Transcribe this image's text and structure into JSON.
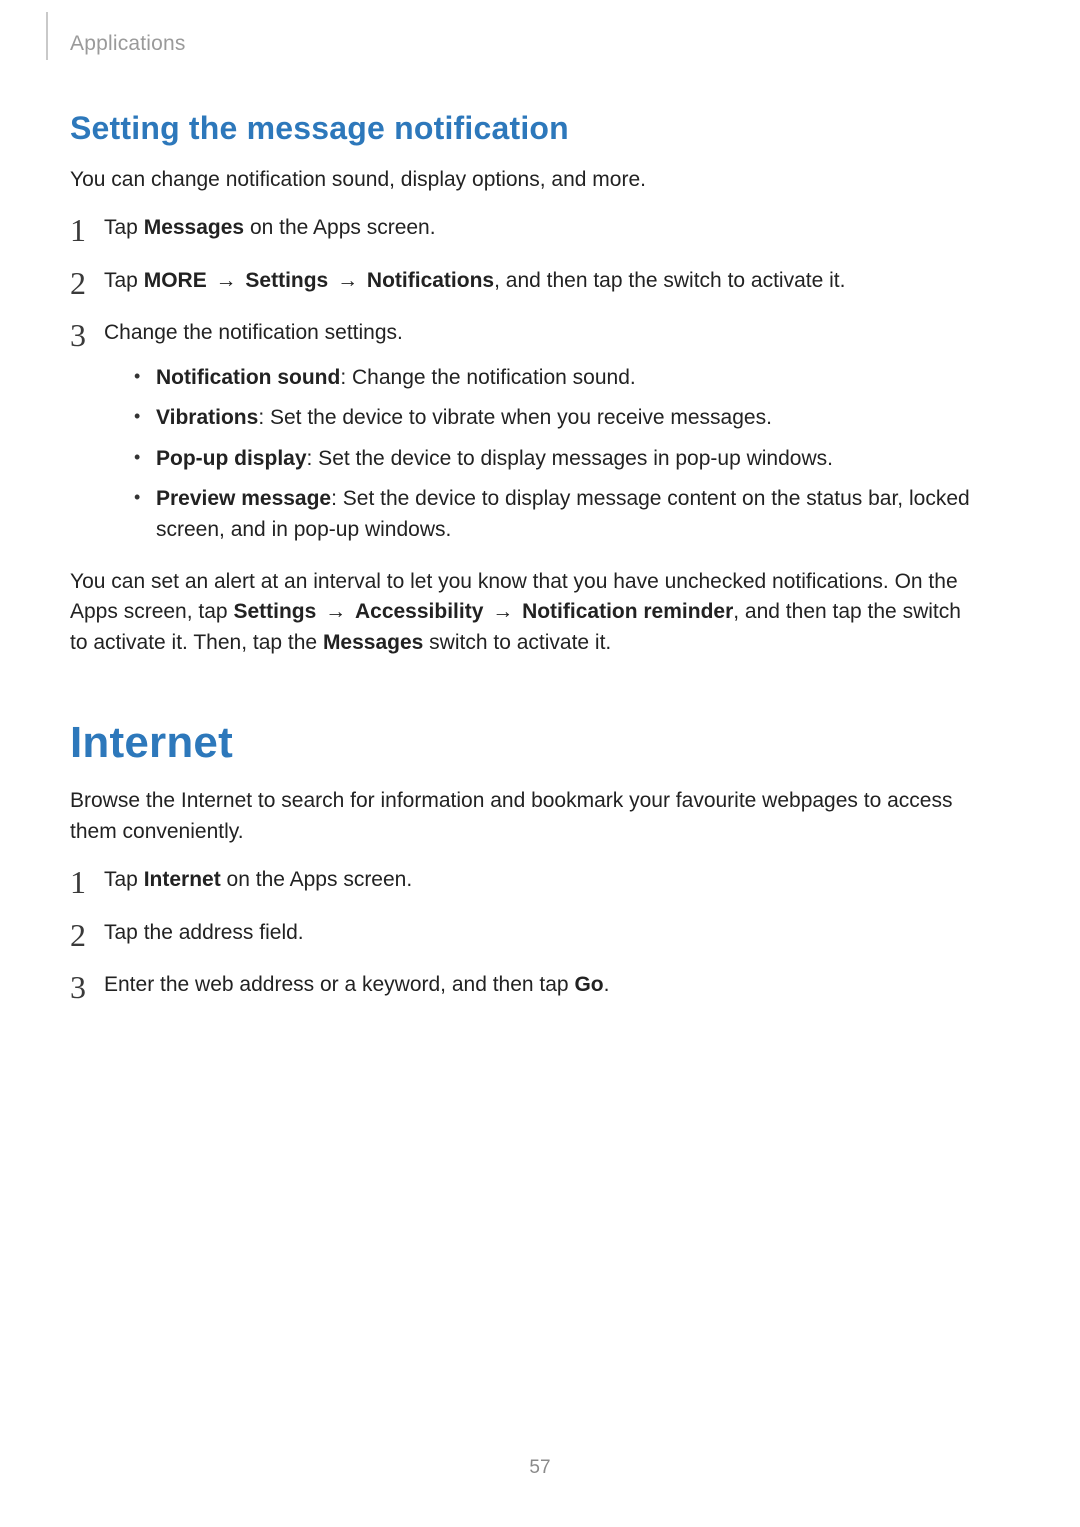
{
  "header": {
    "breadcrumb": "Applications"
  },
  "page_number": "57",
  "arrow": "→",
  "section1": {
    "title": "Setting the message notification",
    "intro": "You can change notification sound, display options, and more.",
    "step1": {
      "prefix": "Tap ",
      "bold": "Messages",
      "suffix": " on the Apps screen."
    },
    "step2": {
      "prefix": "Tap ",
      "more": "MORE",
      "settings": "Settings",
      "notifications": "Notifications",
      "suffix": ", and then tap the switch to activate it."
    },
    "step3": {
      "text": "Change the notification settings.",
      "bullets": [
        {
          "bold": "Notification sound",
          "rest": ": Change the notification sound."
        },
        {
          "bold": "Vibrations",
          "rest": ": Set the device to vibrate when you receive messages."
        },
        {
          "bold": "Pop-up display",
          "rest": ": Set the device to display messages in pop-up windows."
        },
        {
          "bold": "Preview message",
          "rest": ": Set the device to display message content on the status bar, locked screen, and in pop-up windows."
        }
      ]
    },
    "outro": {
      "p1": "You can set an alert at an interval to let you know that you have unchecked notifications. On the Apps screen, tap ",
      "settings": "Settings",
      "accessibility": "Accessibility",
      "reminder": "Notification reminder",
      "p2": ", and then tap the switch to activate it. Then, tap the ",
      "messages": "Messages",
      "p3": " switch to activate it."
    }
  },
  "section2": {
    "title": "Internet",
    "intro": "Browse the Internet to search for information and bookmark your favourite webpages to access them conveniently.",
    "step1": {
      "prefix": "Tap ",
      "bold": "Internet",
      "suffix": " on the Apps screen."
    },
    "step2": {
      "text": "Tap the address field."
    },
    "step3": {
      "prefix": "Enter the web address or a keyword, and then tap ",
      "bold": "Go",
      "suffix": "."
    }
  }
}
